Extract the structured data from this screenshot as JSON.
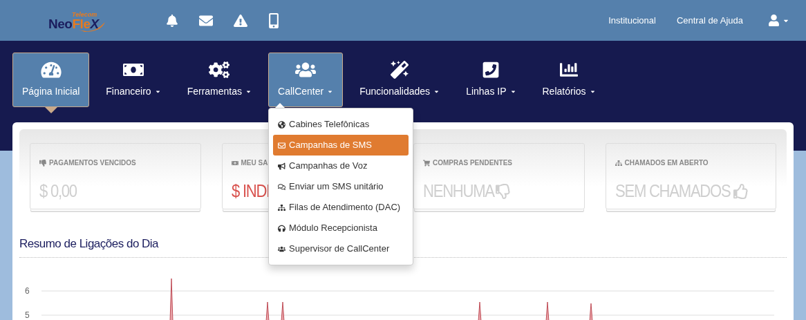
{
  "logo": {
    "tagline": "Telecom",
    "part1": "Neo",
    "part2": "Fle",
    "part3": "X"
  },
  "top_links": [
    "Institucional",
    "Central de Ajuda"
  ],
  "nav": [
    {
      "label": "Página Inicial",
      "selected": true,
      "expanded": false,
      "caret": false
    },
    {
      "label": "Financeiro",
      "selected": false,
      "expanded": false,
      "caret": true
    },
    {
      "label": "Ferramentas",
      "selected": false,
      "expanded": false,
      "caret": true
    },
    {
      "label": "CallCenter",
      "selected": false,
      "expanded": true,
      "caret": true
    },
    {
      "label": "Funcionalidades",
      "selected": false,
      "expanded": false,
      "caret": true
    },
    {
      "label": "Linhas IP",
      "selected": false,
      "expanded": false,
      "caret": true
    },
    {
      "label": "Relatórios",
      "selected": false,
      "expanded": false,
      "caret": true
    }
  ],
  "dropdown": [
    {
      "label": "Cabines Telefônicas",
      "selected": false
    },
    {
      "label": "Campanhas de SMS",
      "selected": true
    },
    {
      "label": "Campanhas de Voz",
      "selected": false
    },
    {
      "label": "Enviar um SMS unitário",
      "selected": false
    },
    {
      "label": "Filas de Atendimento (DAC)",
      "selected": false
    },
    {
      "label": "Módulo Recepcionista",
      "selected": false
    },
    {
      "label": "Supervisor de CallCenter",
      "selected": false
    }
  ],
  "stats": [
    {
      "label": "PAGAMENTOS VENCIDOS",
      "value": "$ 0,00",
      "color": "#cfcfcf"
    },
    {
      "label": "MEU SA",
      "value": "$ INDI",
      "color": "#d9534f"
    },
    {
      "label": "COMPRAS PENDENTES",
      "value": "NENHUMA",
      "color": "#cfcfcf"
    },
    {
      "label": "CHAMADOS EM ABERTO",
      "value": "SEM CHAMADOS",
      "color": "#cfcfcf"
    }
  ],
  "section_title": "Resumo de Ligações do Dia",
  "chart": {
    "y_labels": [
      "6",
      "5"
    ]
  }
}
